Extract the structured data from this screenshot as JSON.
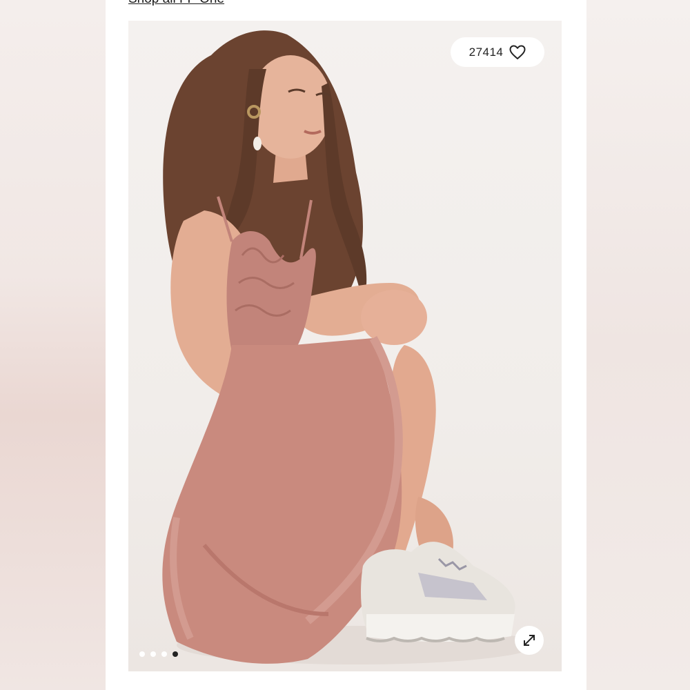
{
  "header": {
    "shop_link": "Shop all FP One"
  },
  "gallery": {
    "image_alt": "Model in rose lace ruffle slip dress with chunky white sneakers",
    "likes": "27414",
    "total_images": 4,
    "active_image": 4,
    "icons": {
      "like": "heart-icon",
      "expand": "expand-arrows-icon"
    }
  },
  "colors": {
    "dress": "#c98a7e",
    "background": "#f3ecea"
  }
}
